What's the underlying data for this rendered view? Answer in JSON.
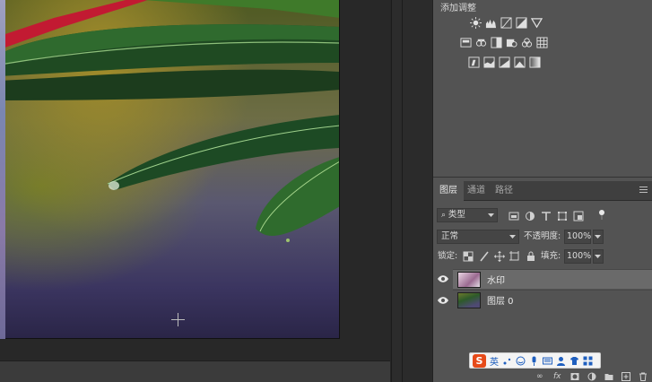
{
  "adjustments": {
    "title": "添加调整",
    "icons_row1": [
      "brightness-icon",
      "levels-icon",
      "curves-icon",
      "exposure-icon",
      "gradient-triangle-icon"
    ],
    "icons_row2": [
      "vibrance-icon",
      "hue-icon",
      "color-balance-icon",
      "bw-icon",
      "photo-filter-icon",
      "channel-mixer-icon",
      "lookup-icon"
    ],
    "icons_row3": [
      "invert-icon",
      "posterize-icon",
      "threshold-icon",
      "selective-color-icon",
      "gradient-map-icon"
    ]
  },
  "layers_panel": {
    "tabs": [
      "图层",
      "通道",
      "路径"
    ],
    "filter_select": "类型",
    "blend_mode": "正常",
    "opacity_label": "不透明度:",
    "opacity_value": "100%",
    "lock_label": "锁定:",
    "fill_label": "填充:",
    "fill_value": "100%",
    "layers": [
      {
        "name": "水印",
        "selected": true
      },
      {
        "name": "图层 0",
        "selected": false
      }
    ]
  },
  "ime": {
    "logo": "S",
    "mode": "英"
  },
  "bottom_tools": [
    "link-icon",
    "fx-icon",
    "mask-icon",
    "adjustment-layer-icon",
    "group-icon",
    "new-layer-icon",
    "delete-icon"
  ],
  "bottom_labels": {
    "link": "∞",
    "fx": "fx"
  },
  "colors": {
    "panel_bg": "#535353",
    "selected_layer": "#6a6a6a",
    "canvas_bg": "#282828"
  }
}
